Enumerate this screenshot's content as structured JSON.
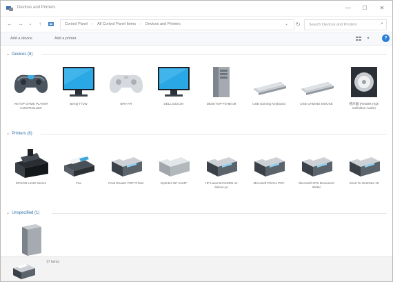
{
  "window": {
    "title": "Devices and Printers",
    "controls": {
      "minimize": "—",
      "maximize": "☐",
      "close": "✕"
    }
  },
  "address_bar": {
    "breadcrumbs": [
      "Control Panel",
      "All Control Panel Items",
      "Devices and Printers"
    ],
    "search_placeholder": "Search Devices and Printers"
  },
  "toolbar": {
    "add_device": "Add a device",
    "add_printer": "Add a printer"
  },
  "groups": {
    "devices": {
      "header": "Devices (8)",
      "items": [
        {
          "label": "AKTOP GAME PLAYER CONTROLLER",
          "icon": "gamepad-icon"
        },
        {
          "label": "BenQ T71W",
          "icon": "monitor-icon"
        },
        {
          "label": "BFH-AR",
          "icon": "gamepad-icon"
        },
        {
          "label": "DELL E2214H",
          "icon": "monitor-icon"
        },
        {
          "label": "DESKTOP-F3HB7J9",
          "icon": "computer-tower-icon"
        },
        {
          "label": "USB Gaming Keyboard",
          "icon": "keyboard-icon"
        },
        {
          "label": "USB GAMING MOUSE",
          "icon": "keyboard-icon"
        },
        {
          "label": "扬声器 (Realtek High Definition Audio)",
          "icon": "speaker-icon"
        }
      ]
    },
    "printers": {
      "header": "Printers (8)",
      "items": [
        {
          "label": "EPSON L1110 Series",
          "icon": "inkjet-printer-icon"
        },
        {
          "label": "Fax",
          "icon": "fax-icon"
        },
        {
          "label": "Foxit Reader PDF Printer",
          "icon": "printer-icon"
        },
        {
          "label": "Gprinter GP-1134T",
          "icon": "printer-faded-icon"
        },
        {
          "label": "HP LaserJet M1005 on deliver-pc",
          "icon": "printer-icon"
        },
        {
          "label": "Microsoft Print to PDF",
          "icon": "printer-icon"
        },
        {
          "label": "Microsoft XPS Document Writer",
          "icon": "printer-icon"
        },
        {
          "label": "Send To OneNote 16",
          "icon": "printer-icon"
        }
      ]
    },
    "unspecified": {
      "header": "Unspecified (1)",
      "items": [
        {
          "label": "",
          "icon": "computer-tower-icon"
        }
      ]
    }
  },
  "status_bar": {
    "text": "17 items"
  },
  "colors": {
    "group_header": "#2d6da6",
    "help_button": "#2a7fd4",
    "monitor_screen": "#2aa8e6"
  }
}
